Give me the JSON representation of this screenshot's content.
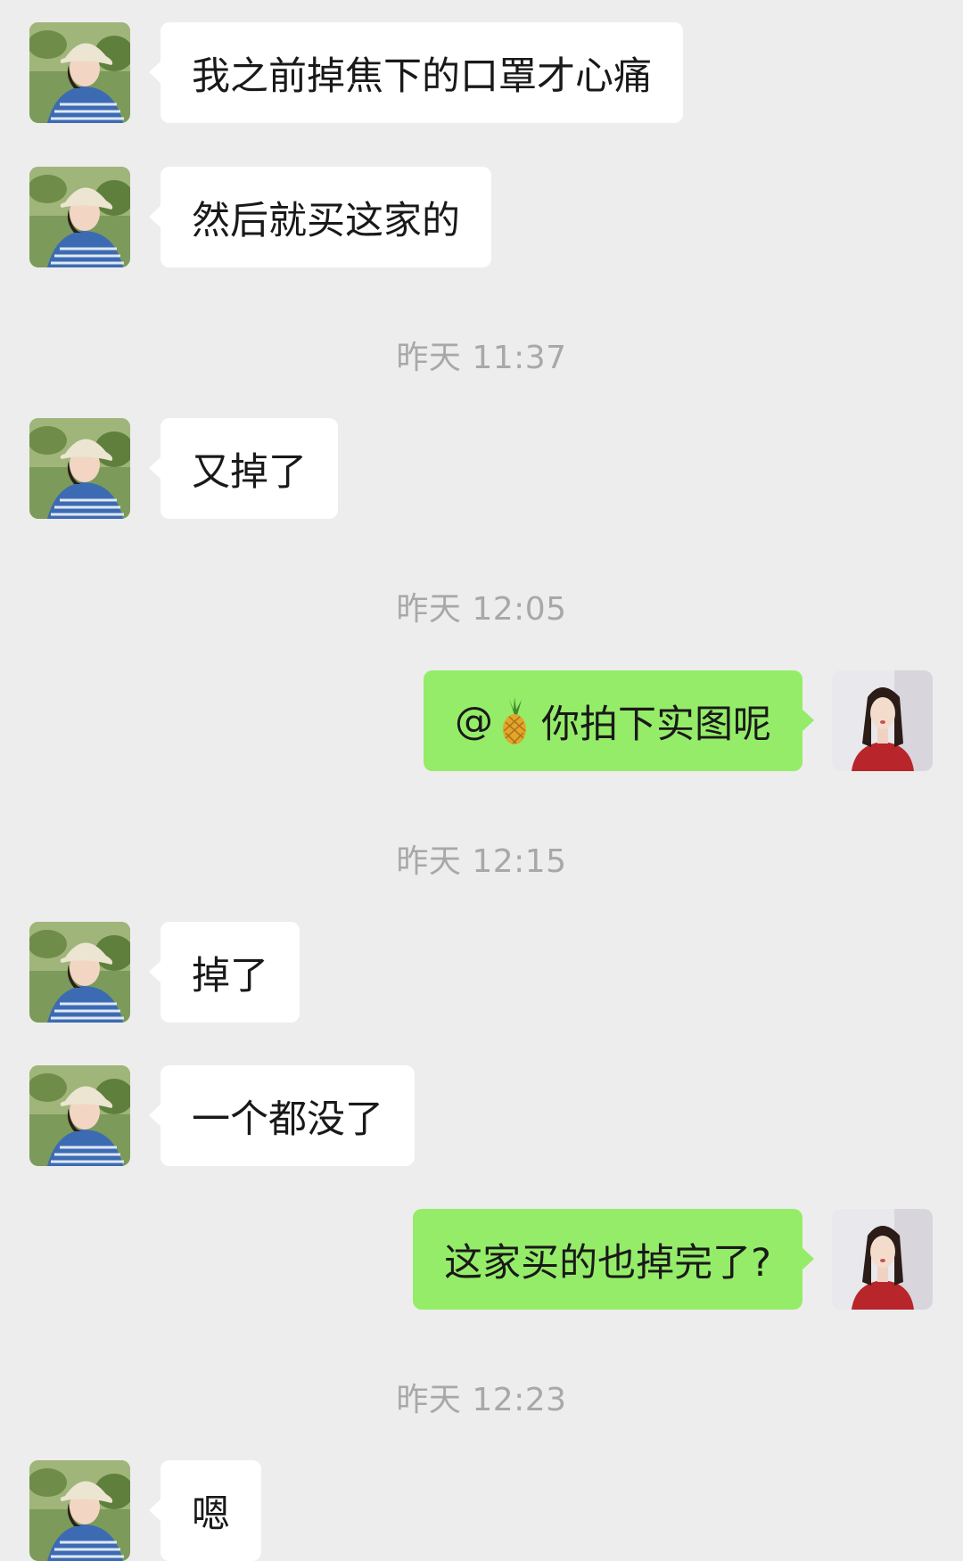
{
  "messages": [
    {
      "side": "left",
      "text": "我之前掉焦下的口罩才心痛"
    },
    {
      "side": "left",
      "text": "然后就买这家的"
    },
    {
      "timestamp": "昨天 11:37"
    },
    {
      "side": "left",
      "text": "又掉了"
    },
    {
      "timestamp": "昨天 12:05"
    },
    {
      "side": "right",
      "mention_prefix": "@",
      "mention_icon": "pineapple-emoji",
      "text": "你拍下实图呢"
    },
    {
      "timestamp": "昨天 12:15"
    },
    {
      "side": "left",
      "text": "掉了"
    },
    {
      "side": "left",
      "text": "一个都没了"
    },
    {
      "side": "right",
      "text": "这家买的也掉完了?"
    },
    {
      "timestamp": "昨天 12:23"
    },
    {
      "side": "left",
      "text": "嗯"
    }
  ],
  "colors": {
    "background": "#ededed",
    "incoming_bubble": "#ffffff",
    "outgoing_bubble": "#95ec69",
    "timestamp_text": "#a8a8a8"
  },
  "avatars": {
    "incoming": "contact-avatar-hat-girl",
    "outgoing": "self-avatar-red-top-girl"
  }
}
